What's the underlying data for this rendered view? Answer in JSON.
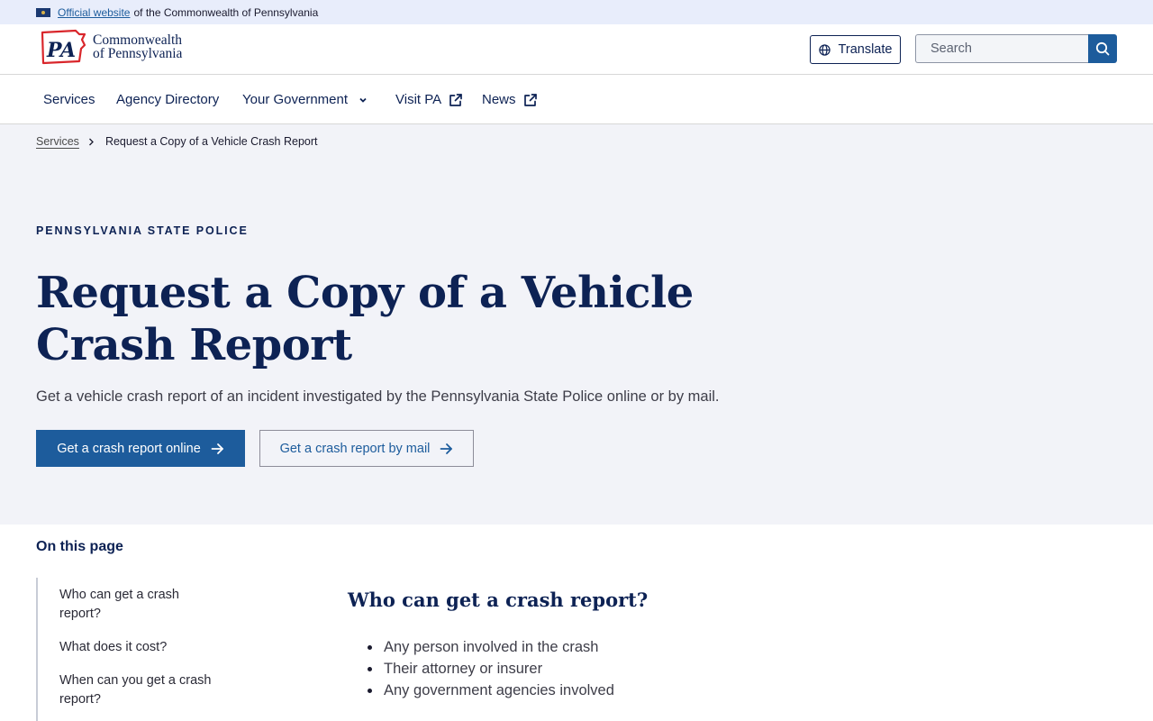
{
  "official_banner": {
    "link_text": "Official website",
    "suffix": "of the Commonwealth of Pennsylvania"
  },
  "header": {
    "logo_line1": "Commonwealth",
    "logo_line2": "of Pennsylvania",
    "logo_mark_text": "PA",
    "translate_label": "Translate",
    "search_placeholder": "Search"
  },
  "nav": {
    "items": [
      {
        "label": "Services"
      },
      {
        "label": "Agency Directory"
      },
      {
        "label": "Your Government"
      },
      {
        "label": "Visit PA"
      },
      {
        "label": "News"
      }
    ]
  },
  "breadcrumb": {
    "parent": "Services",
    "current": "Request a Copy of a Vehicle Crash Report"
  },
  "hero": {
    "agency": "PENNSYLVANIA STATE POLICE",
    "title": "Request a Copy of a Vehicle Crash Report",
    "intro": "Get a vehicle crash report of an incident investigated by the Pennsylvania State Police online or by mail.",
    "primary_button": "Get a crash report online",
    "secondary_button": "Get a crash report by mail"
  },
  "on_this_page": {
    "title": "On this page",
    "items": [
      "Who can get a crash report?",
      "What does it cost?",
      "When can you get a crash report?"
    ]
  },
  "section": {
    "title": "Who can get a crash report?",
    "bullets": [
      "Any person involved in the crash",
      "Their attorney or insurer",
      "Any government agencies involved"
    ]
  },
  "colors": {
    "navy": "#0d2254",
    "brand_blue": "#1d5c9c",
    "banner_bg": "#e8edfb",
    "hero_bg": "#f2f3f8",
    "logo_red": "#d9262b"
  }
}
